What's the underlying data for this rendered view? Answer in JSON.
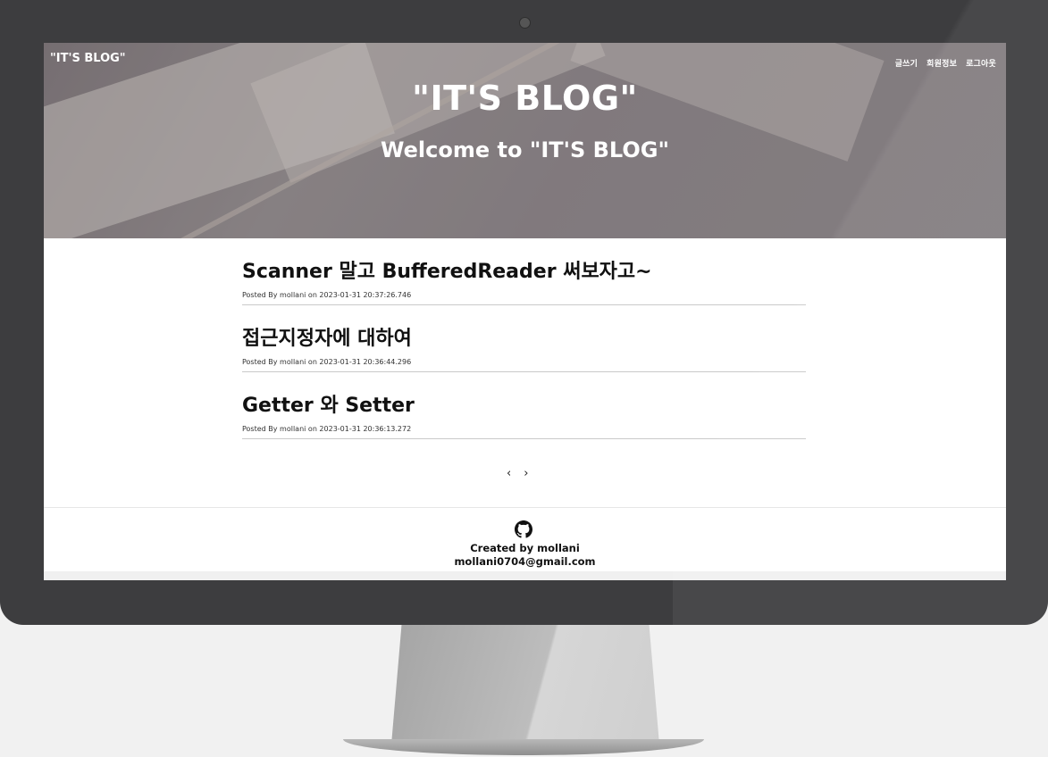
{
  "header": {
    "brand": "\"IT'S BLOG\"",
    "title": "\"IT'S BLOG\"",
    "subtitle": "Welcome to \"IT'S BLOG\"",
    "nav": [
      "글쓰기",
      "회원정보",
      "로그아웃"
    ]
  },
  "posts": [
    {
      "title": "Scanner 말고 BufferedReader 써보자고~",
      "meta": "Posted By mollani on 2023-01-31 20:37:26.746"
    },
    {
      "title": "접근지정자에 대하여",
      "meta": "Posted By mollani on 2023-01-31 20:36:44.296"
    },
    {
      "title": "Getter 와 Setter",
      "meta": "Posted By mollani on 2023-01-31 20:36:13.272"
    }
  ],
  "pager": {
    "prev": "‹",
    "next": "›"
  },
  "footer": {
    "icon": "github-icon",
    "line1": "Created by mollani",
    "line2": "mollani0704@gmail.com"
  }
}
